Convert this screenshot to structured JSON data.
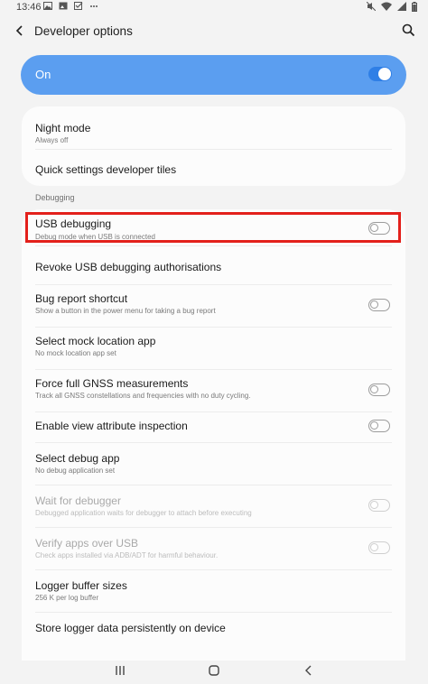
{
  "status_bar": {
    "time": "13:46",
    "left_icons": [
      "image-icon",
      "gallery-icon",
      "check-square-icon",
      "more-dots-icon"
    ],
    "right_icons": [
      "mute-icon",
      "wifi-icon",
      "signal-icon",
      "battery-icon"
    ]
  },
  "app_bar": {
    "title": "Developer options"
  },
  "master_switch": {
    "label": "On",
    "checked": true,
    "accent": "#5b9ef0"
  },
  "top_items": [
    {
      "title": "Night mode",
      "summary": "Always off"
    },
    {
      "title": "Quick settings developer tiles",
      "summary": ""
    }
  ],
  "section_header": "Debugging",
  "debug_items": [
    {
      "title": "USB debugging",
      "summary": "Debug mode when USB is connected",
      "toggle": false,
      "enabled": true
    },
    {
      "title": "Revoke USB debugging authorisations",
      "summary": "",
      "enabled": true
    },
    {
      "title": "Bug report shortcut",
      "summary": "Show a button in the power menu for taking a bug report",
      "toggle": false,
      "enabled": true
    },
    {
      "title": "Select mock location app",
      "summary": "No mock location app set",
      "enabled": true
    },
    {
      "title": "Force full GNSS measurements",
      "summary": "Track all GNSS constellations and frequencies with no duty cycling.",
      "toggle": false,
      "enabled": true
    },
    {
      "title": "Enable view attribute inspection",
      "summary": "",
      "toggle": false,
      "enabled": true
    },
    {
      "title": "Select debug app",
      "summary": "No debug application set",
      "enabled": true
    },
    {
      "title": "Wait for debugger",
      "summary": "Debugged application waits for debugger to attach before executing",
      "toggle": false,
      "enabled": false
    },
    {
      "title": "Verify apps over USB",
      "summary": "Check apps installed via ADB/ADT for harmful behaviour.",
      "toggle": false,
      "enabled": false
    },
    {
      "title": "Logger buffer sizes",
      "summary": "256 K per log buffer",
      "enabled": true
    },
    {
      "title": "Store logger data persistently on device",
      "summary": "",
      "enabled": true
    }
  ],
  "highlight_color": "#e3201b",
  "nav_bar": {
    "icons": [
      "recents-icon",
      "home-icon",
      "back-icon"
    ]
  }
}
